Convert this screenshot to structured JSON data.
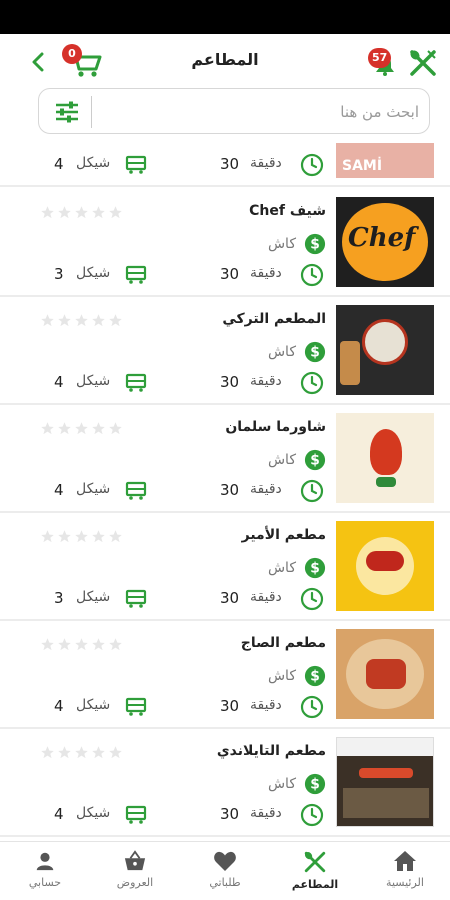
{
  "app": {
    "title": "المطاعم",
    "cart_count": "0",
    "notifications_count": "57"
  },
  "search": {
    "placeholder": "ابحث من هنا"
  },
  "colors": {
    "accent": "#2f9e3a",
    "badge": "#d6312a"
  },
  "restaurants": [
    {
      "name": "",
      "payment": "",
      "time_value": "30",
      "time_unit": "دقيقة",
      "delivery_value": "4",
      "delivery_unit": "شيكل",
      "rating_stars": 0,
      "logo_text": "SAMİ"
    },
    {
      "name": "شيف Chef",
      "payment": "كاش",
      "time_value": "30",
      "time_unit": "دقيقة",
      "delivery_value": "3",
      "delivery_unit": "شيكل",
      "rating_stars": 0,
      "logo_text": "Chef"
    },
    {
      "name": "المطعم التركي",
      "payment": "كاش",
      "time_value": "30",
      "time_unit": "دقيقة",
      "delivery_value": "4",
      "delivery_unit": "شيكل",
      "rating_stars": 0,
      "logo_text": ""
    },
    {
      "name": "شاورما سلمان",
      "payment": "كاش",
      "time_value": "30",
      "time_unit": "دقيقة",
      "delivery_value": "4",
      "delivery_unit": "شيكل",
      "rating_stars": 0,
      "logo_text": ""
    },
    {
      "name": "مطعم الأمير",
      "payment": "كاش",
      "time_value": "30",
      "time_unit": "دقيقة",
      "delivery_value": "3",
      "delivery_unit": "شيكل",
      "rating_stars": 0,
      "logo_text": ""
    },
    {
      "name": "مطعم الصاج",
      "payment": "كاش",
      "time_value": "30",
      "time_unit": "دقيقة",
      "delivery_value": "4",
      "delivery_unit": "شيكل",
      "rating_stars": 0,
      "logo_text": ""
    },
    {
      "name": "مطعم التايلاندي",
      "payment": "كاش",
      "time_value": "30",
      "time_unit": "دقيقة",
      "delivery_value": "4",
      "delivery_unit": "شيكل",
      "rating_stars": 0,
      "logo_text": ""
    }
  ],
  "nav": {
    "items": [
      {
        "label": "حسابي",
        "icon": "user-icon"
      },
      {
        "label": "العروض",
        "icon": "basket-icon"
      },
      {
        "label": "طلباتي",
        "icon": "heart-icon"
      },
      {
        "label": "المطاعم",
        "icon": "utensils-icon",
        "active": true
      },
      {
        "label": "الرئيسية",
        "icon": "home-icon"
      }
    ]
  }
}
